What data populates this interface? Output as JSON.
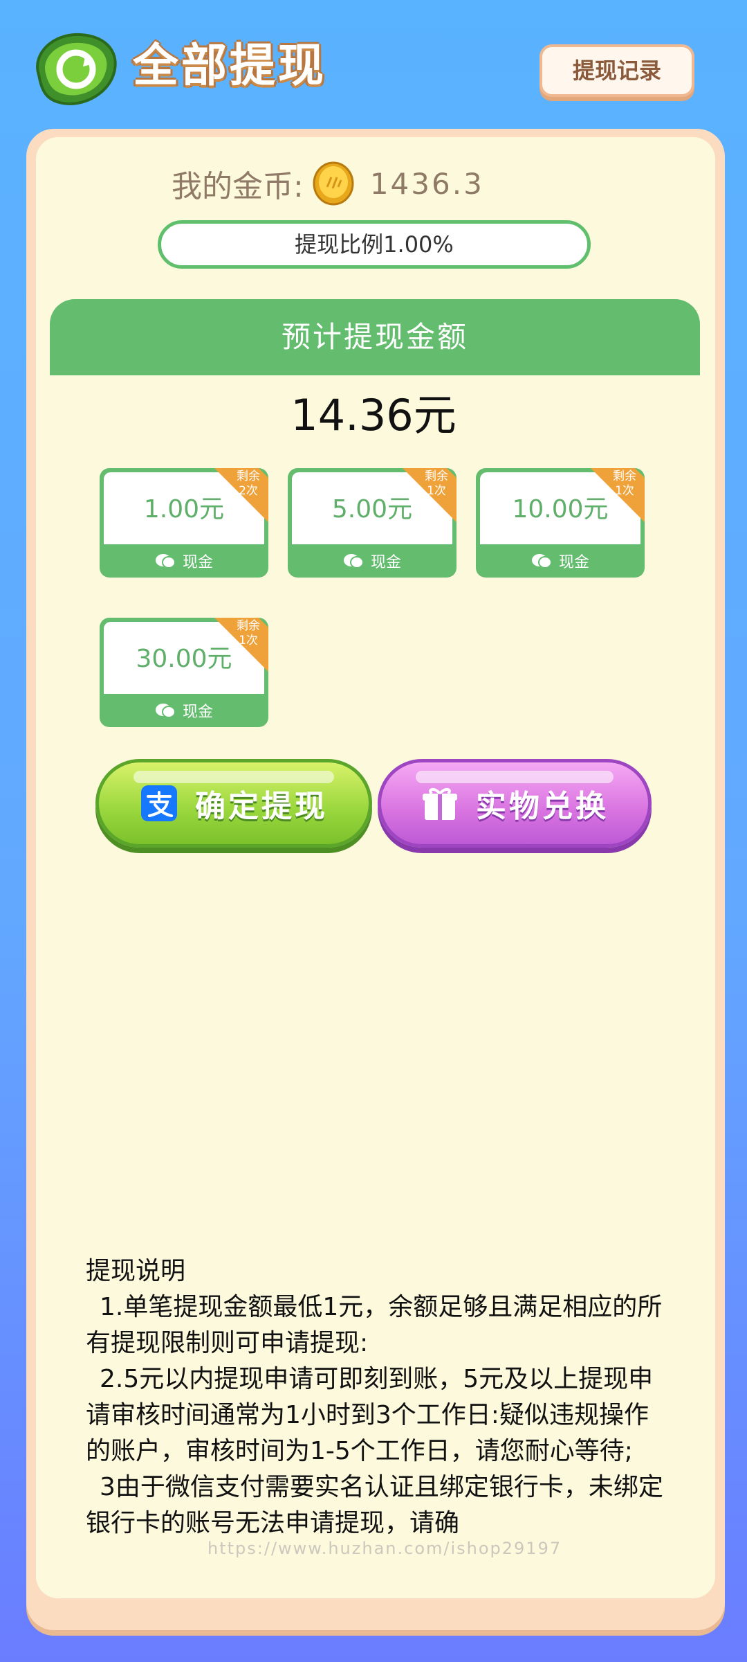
{
  "header": {
    "title": "全部提现",
    "record_label": "提现记录"
  },
  "coins": {
    "label": "我的金币:",
    "value": "1436.3"
  },
  "ratio": {
    "label": "提现比例1.00%"
  },
  "estimate": {
    "header": "预计提现金额",
    "amount": "14.36元"
  },
  "options": [
    {
      "amount": "1.00元",
      "remain_line1": "剩余",
      "remain_line2": "2次",
      "type": "现金"
    },
    {
      "amount": "5.00元",
      "remain_line1": "剩余",
      "remain_line2": "1次",
      "type": "现金"
    },
    {
      "amount": "10.00元",
      "remain_line1": "剩余",
      "remain_line2": "1次",
      "type": "现金"
    },
    {
      "amount": "30.00元",
      "remain_line1": "剩余",
      "remain_line2": "1次",
      "type": "现金"
    }
  ],
  "buttons": {
    "confirm_label": "确定提现",
    "exchange_label": "实物兑换"
  },
  "description": {
    "title": "提现说明",
    "p1": "1.单笔提现金额最低1元，余额足够且满足相应的所有提现限制则可申请提现:",
    "p2": "2.5元以内提现申请可即刻到账，5元及以上提现申请审核时间通常为1小时到3个工作日:疑似违规操作的账户，审核时间为1-5个工作日，请您耐心等待;",
    "p3": "3由于微信支付需要实名认证且绑定银行卡，未绑定银行卡的账号无法申请提现，请确"
  },
  "watermark": "https://www.huzhan.com/ishop29197",
  "colors": {
    "accent_green": "#64bd6f",
    "card_bg": "#fdf9dd",
    "background_blue": "#5ab3ff"
  }
}
